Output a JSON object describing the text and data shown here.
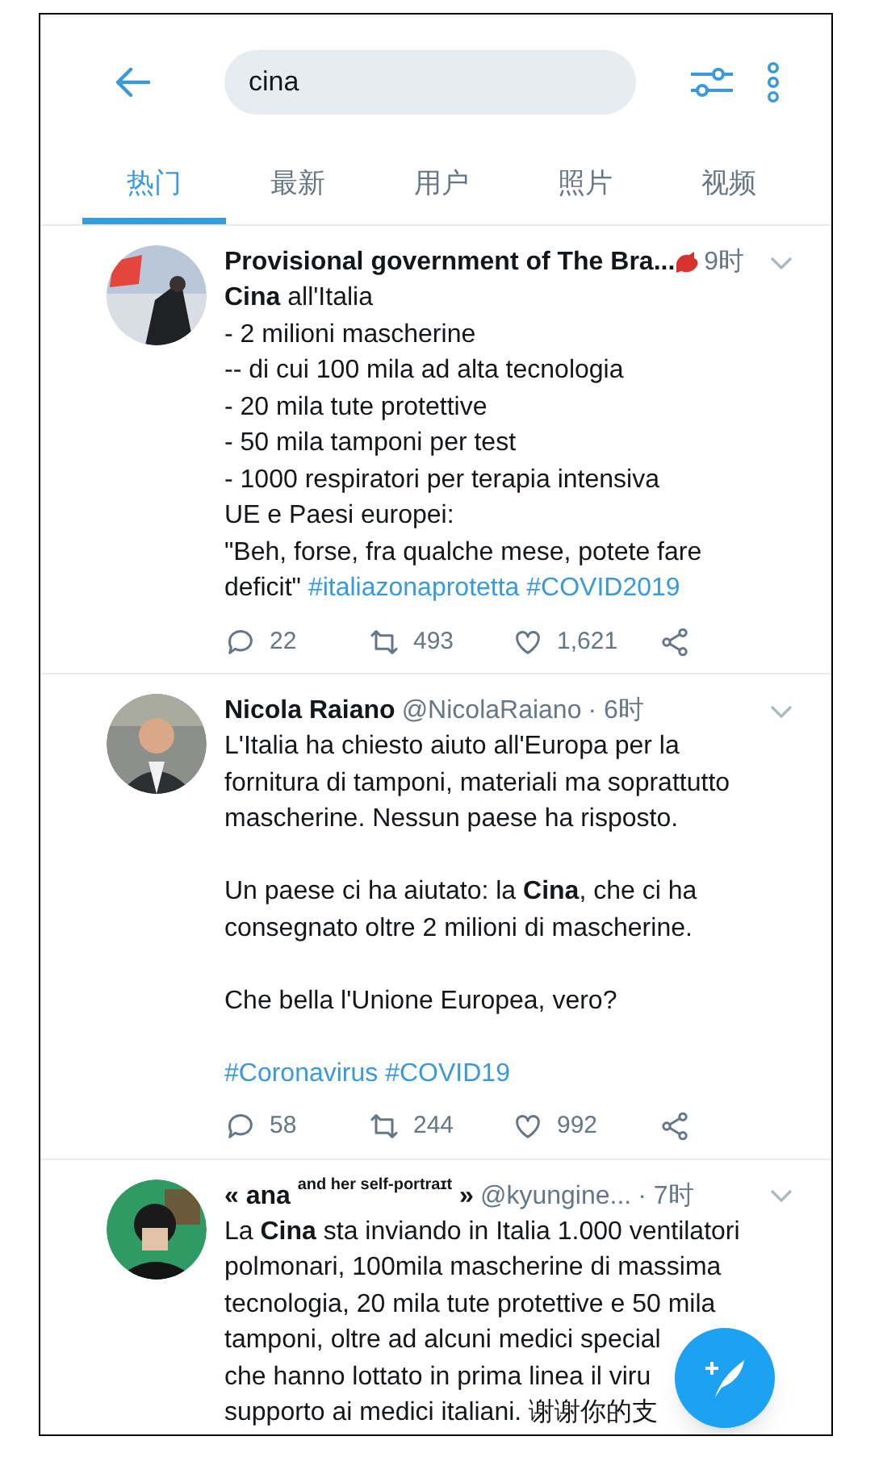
{
  "search": {
    "value": "cina"
  },
  "tabs": [
    {
      "label": "热门",
      "selected": true
    },
    {
      "label": "最新",
      "selected": false
    },
    {
      "label": "用户",
      "selected": false
    },
    {
      "label": "照片",
      "selected": false
    },
    {
      "label": "视频",
      "selected": false
    }
  ],
  "tweets": [
    {
      "avatar": {
        "kind": "picture"
      },
      "name": "Provisional government of The Bra...",
      "bird_badge": true,
      "time": "9时",
      "paragraphs": [
        {
          "lines": [
            {
              "text": "**Cina** all'Italia"
            },
            {
              "text": "- 2 milioni mascherine"
            },
            {
              "text": "-- di cui 100 mila ad alta tecnologia"
            },
            {
              "text": "- 20 mila tute protettive"
            },
            {
              "text": "- 50 mila tamponi per test"
            },
            {
              "text": "- 1000 respiratori per terapia intensiva"
            },
            {
              "text": "UE e Paesi europei:"
            },
            {
              "text": "\"Beh, forse, fra qualche mese, potete fare"
            },
            {
              "text": "deficit\"",
              "hashtags": "#italiazonaprotetta #COVID2019"
            }
          ]
        }
      ],
      "replies": "22",
      "retweets": "493",
      "likes": "1,621"
    },
    {
      "avatar": {
        "kind": "picture"
      },
      "name": "Nicola Raiano",
      "handle": "@NicolaRaiano",
      "time": "· 6时",
      "paragraphs": [
        {
          "lines": [
            {
              "text": "L'Italia ha chiesto aiuto all'Europa per la"
            },
            {
              "text": "fornitura di tamponi, materiali ma soprattutto"
            },
            {
              "text": "mascherine. Nessun paese ha risposto."
            }
          ]
        },
        {
          "lines": [
            {
              "text": "Un paese ci ha aiutato: la **Cina**, che ci ha"
            },
            {
              "text": "consegnato oltre 2 milioni di mascherine."
            }
          ]
        },
        {
          "lines": [
            {
              "text": "Che bella l'Unione Europea, vero?"
            }
          ]
        },
        {
          "lines": [
            {
              "hashtags": "#Coronavirus #COVID19"
            }
          ]
        }
      ],
      "replies": "58",
      "retweets": "244",
      "likes": "992"
    },
    {
      "avatar": {
        "kind": "picture"
      },
      "name": "« **ana** $^{and her self-portraɪt}$ »",
      "handle": "@kyungine...",
      "time": "· 7时",
      "paragraphs": [
        {
          "lines": [
            {
              "text": "La **Cina** sta inviando in Italia 1.000 ventilatori"
            },
            {
              "text": "polmonari, 100mila mascherine di massima"
            },
            {
              "text": "tecnologia, 20 mila tute protettive e 50 mila"
            }
          ]
        },
        {
          "continued": true,
          "lines": [
            {
              "text": "tamponi, oltre ad alcuni medici special"
            },
            {
              "text": "che hanno lottato in prima linea il viru"
            },
            {
              "text": "supporto ai medici italiani. 谢谢你的支"
            }
          ]
        }
      ]
    }
  ]
}
